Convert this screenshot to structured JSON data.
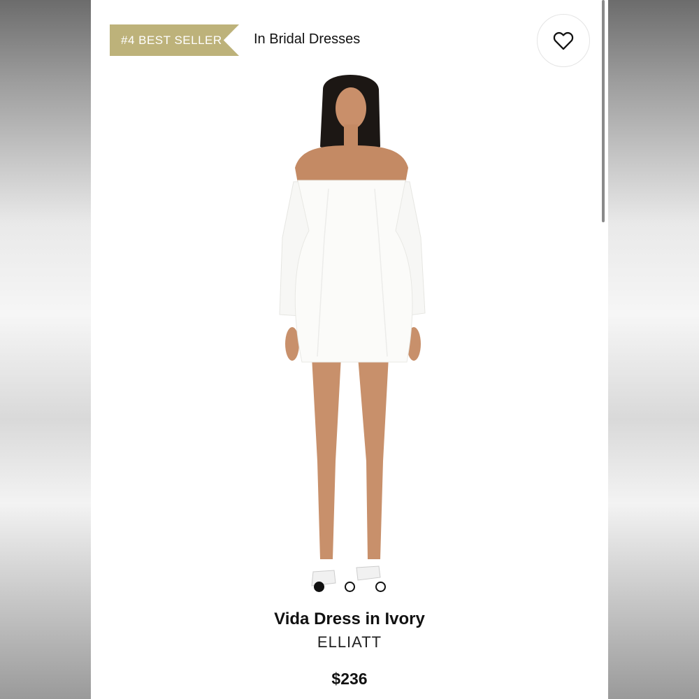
{
  "badge": {
    "text": "#4 BEST SELLER",
    "color": "#bdb27a"
  },
  "category": {
    "text": "In Bridal Dresses"
  },
  "favorite": {
    "icon": "heart-outline-icon"
  },
  "product_image": {
    "subject": "model wearing white off-shoulder mini dress"
  },
  "carousel": {
    "total": 3,
    "active_index": 0
  },
  "product": {
    "name": "Vida Dress in Ivory",
    "brand": "ELLIATT",
    "price": "$236"
  }
}
